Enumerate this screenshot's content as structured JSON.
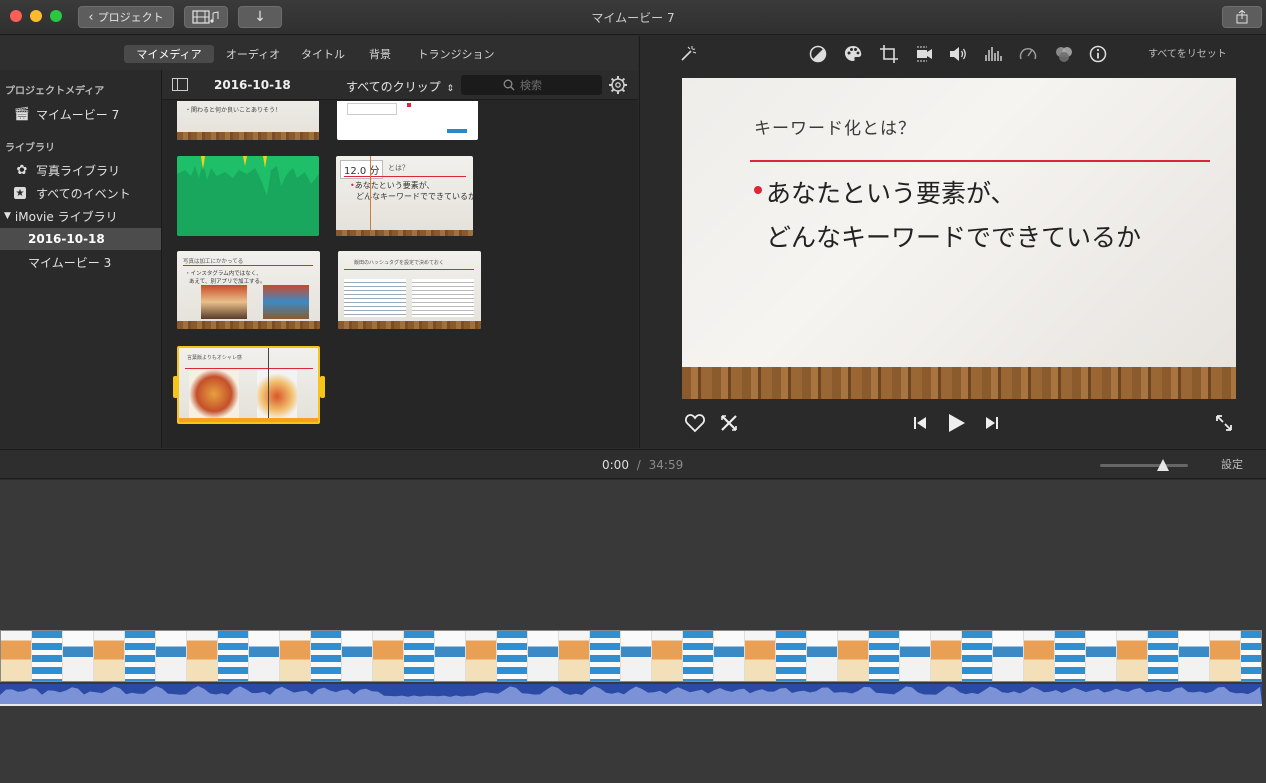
{
  "window": {
    "title": "マイムービー 7"
  },
  "titlebar": {
    "back_label": "プロジェクト"
  },
  "browser": {
    "tabs": [
      {
        "label": "マイメディア",
        "active": true
      },
      {
        "label": "オーディオ",
        "active": false
      },
      {
        "label": "タイトル",
        "active": false
      },
      {
        "label": "背景",
        "active": false
      },
      {
        "label": "トランジション",
        "active": false
      }
    ]
  },
  "sidebar": {
    "project_media_header": "プロジェクトメディア",
    "project_item": "マイムービー 7",
    "library_header": "ライブラリ",
    "photos_library": "写真ライブラリ",
    "all_events": "すべてのイベント",
    "imovie_library": "iMovie ライブラリ",
    "event_selected": "2016-10-18",
    "event_movie": "マイムービー 3"
  },
  "browser_toolbar": {
    "date": "2016-10-18",
    "filter": "すべてのクリップ",
    "search_placeholder": "検索"
  },
  "clips": {
    "c1_line1": "関わると何か良いことありそう！",
    "c4_duration": "12.0 分",
    "c4_title": "とは？",
    "c4_line1": "あなたという要素が、",
    "c4_line2": "どんなキーワードでできているか",
    "c5_title": "写真は加工にかかってる",
    "c5_line1": "インスタグラム内ではなく、",
    "c5_line2": "あえて、別アプリで加工する。",
    "c6_title": "飯田のハッシュタグを設定で決めておく",
    "c7_title": "言葉飯よりもオシャレ感"
  },
  "viewer": {
    "reset_label": "すべてをリセット",
    "slide_title": "キーワード化とは？",
    "slide_line1": "あなたという要素が、",
    "slide_line2": "どんなキーワードでできているか"
  },
  "timeline": {
    "current_time": "0:00",
    "separator": "/",
    "total_time": "34:59",
    "settings_label": "設定",
    "zoom_level": 0.72
  },
  "colors": {
    "accent_red": "#d8283a",
    "selection_yellow": "#f5c518",
    "audio_blue": "#2b4aa6",
    "clip_green": "#1fbf6a"
  }
}
